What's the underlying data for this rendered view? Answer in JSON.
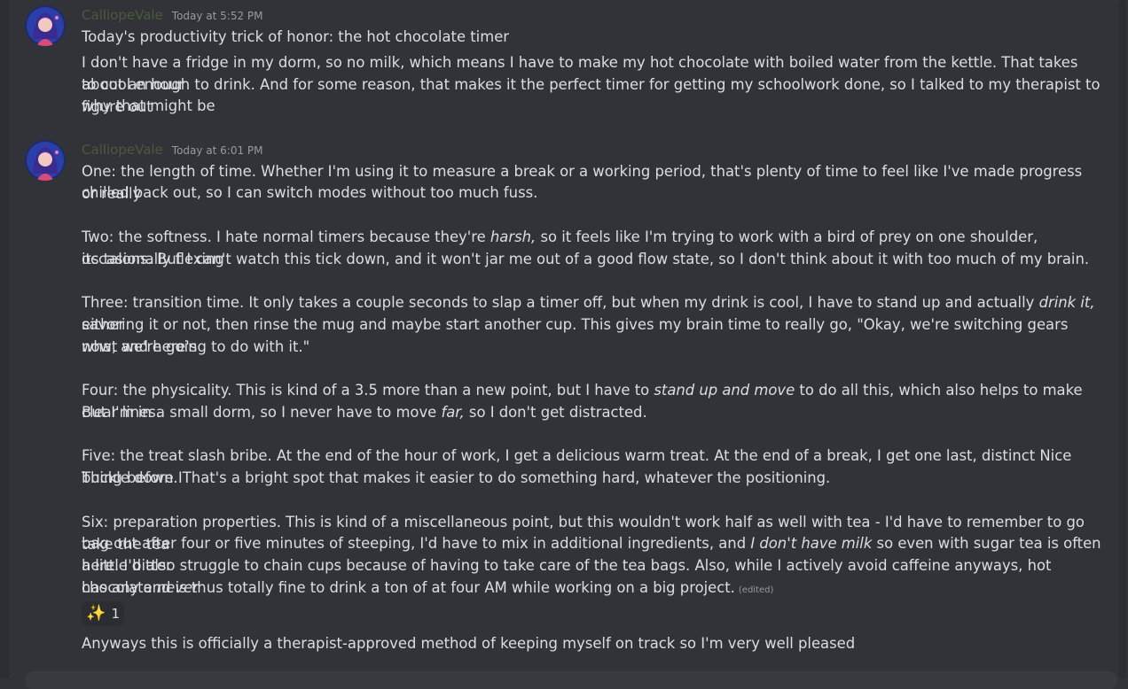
{
  "messages": [
    {
      "username": "CalliopeVale",
      "timestamp": "Today at 5:52 PM",
      "title": "Today's productivity trick of honor: the hot chocolate timer",
      "body": [
        "I don't have a fridge in my dorm, so no milk, which means I have to make my hot chocolate with boiled water from the kettle. That takes about an hour",
        "to cool enough to drink. And for some reason, that makes it the perfect timer for getting my schoolwork done, so I talked to my therapist to figure out",
        "why that might be"
      ]
    },
    {
      "username": "CalliopeVale",
      "timestamp": "Today at 6:01 PM",
      "p1": [
        "One: the length of time. Whether I'm using it to measure a break or a working period, that's plenty of time to feel like I've made progress or really",
        "chilled back out, so I can switch modes without too much fuss."
      ],
      "p2": {
        "l1a": "Two: the softness. I hate normal timers because they're ",
        "l1i": "harsh,",
        "l1b": " so it feels like I'm trying to work with a bird of prey on one shoulder, occasionally flexing",
        "l2": "its talons. But I can't watch this tick down, and it won't jar me out of a good flow state, so I don't think about it with too much of my brain."
      },
      "p3": {
        "l1a": "Three: transition time. It only takes a couple seconds to slap a timer off, but when my drink is cool, I have to stand up and actually ",
        "l1i": "drink it,",
        "l1b": " either",
        "l2": "savoring it or not, then rinse the mug and maybe start another cup. This gives my brain time to really go, \"Okay, we're switching gears now, and here's",
        "l3": "what we're going to do with it.\""
      },
      "p4": {
        "l1a": "Four: the physicality. This is kind of a 3.5 more than a new point, but I have to ",
        "l1i": "stand up and move",
        "l1b": " to do all this, which also helps to make clear lines.",
        "l2a": "But I'm in a small dorm, so I never have to move ",
        "l2i": "far,",
        "l2b": " so I don't get distracted."
      },
      "p5": [
        "Five: the treat slash bribe. At the end of the hour of work, I get a delicious warm treat. At the end of a break, I get one last, distinct Nice Thing before I",
        "buckle down. That's a bright spot that makes it easier to do something hard, whatever the positioning."
      ],
      "p6": {
        "l1": "Six: preparation properties. This is kind of a miscellaneous point, but this wouldn't work half as well with tea - I'd have to remember to go take the tea",
        "l2a": "bag out after four or five minutes of steeping, I'd have to mix in additional ingredients, and ",
        "l2i": "I don't have milk",
        "l2b": " so even with sugar tea is often a little bitter",
        "l3a": "here. I'd also struggle to chain cups because of having to take care of the tea bags. Also, while I actively avoid caffeine anyways, hot chocolate ",
        "l3i": "never",
        "l4": "has any and is thus totally fine to drink a ton of at four AM while working on a big project.",
        "edited": "(edited)"
      },
      "reaction": {
        "emoji": "✨",
        "count": "1"
      },
      "followup": "Anyways this is officially a therapist-approved method of keeping myself on track so I'm very well pleased"
    }
  ]
}
